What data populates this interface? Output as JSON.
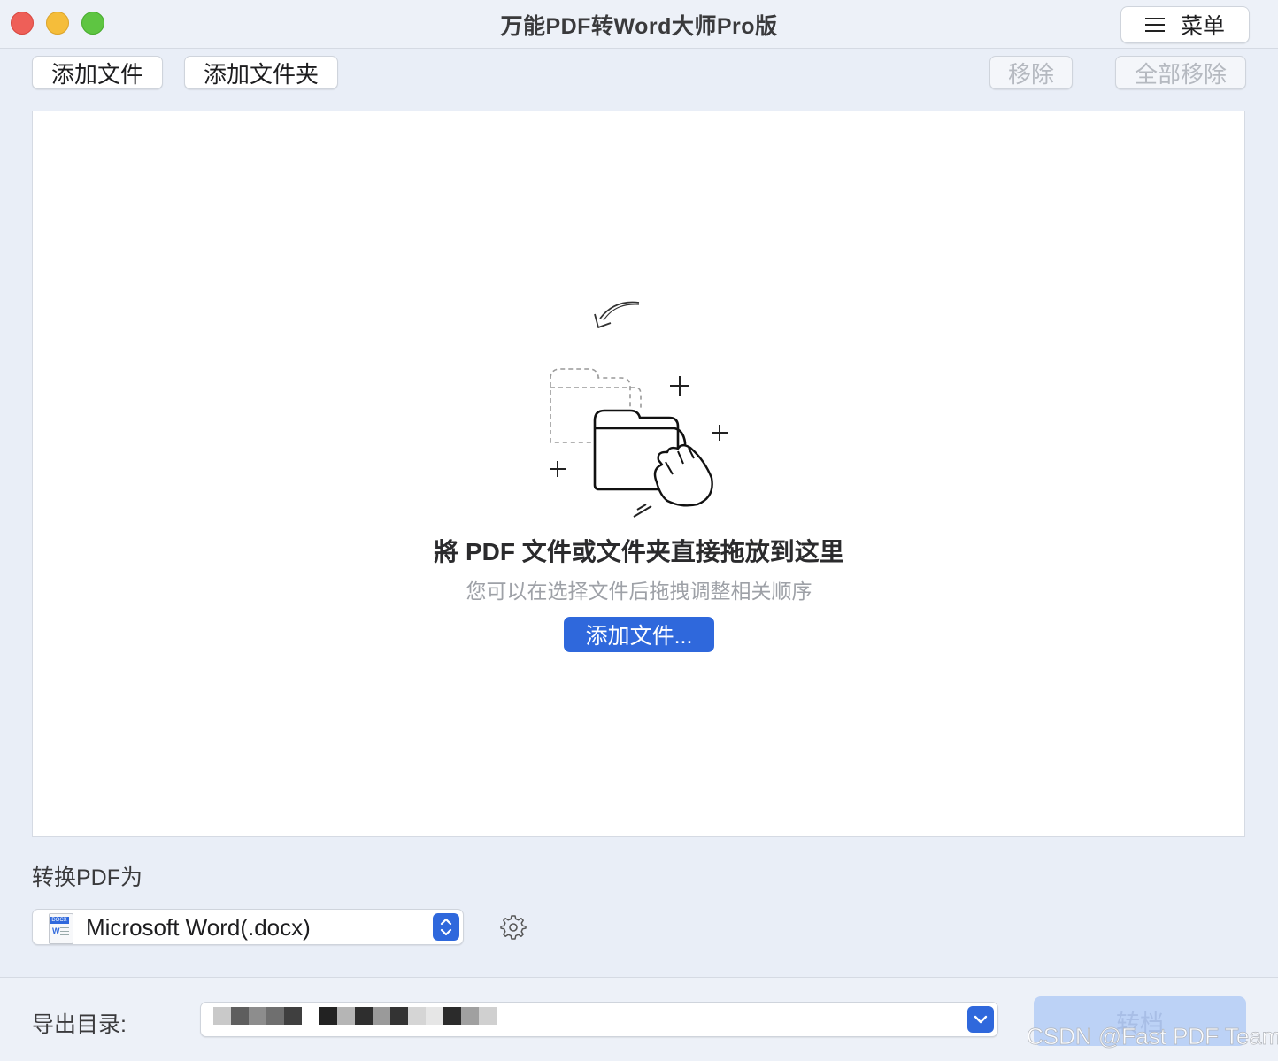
{
  "window": {
    "title": "万能PDF转Word大师Pro版",
    "menu_label": "菜单"
  },
  "toolbar": {
    "add_file": "添加文件",
    "add_folder": "添加文件夹",
    "remove": "移除",
    "remove_all": "全部移除"
  },
  "dropzone": {
    "title": "將 PDF  文件或文件夹直接拖放到这里",
    "subtitle": "您可以在选择文件后拖拽调整相关顺序",
    "add_button": "添加文件..."
  },
  "conversion": {
    "label": "转换PDF为",
    "format_value": "Microsoft Word(.docx)",
    "format_icon_tag": "DOCX",
    "format_icon_letter": "W"
  },
  "export": {
    "label": "导出目录:",
    "path_value_redacted": true
  },
  "actions": {
    "convert": "转档"
  },
  "watermark": "CSDN @Fast PDF Team",
  "colors": {
    "accent": "#2f68dc",
    "convert_disabled": "#bcd2f6",
    "window_bg": "#e9eef7"
  },
  "icons": {
    "close": "close-icon",
    "minimize": "minimize-icon",
    "maximize": "maximize-icon",
    "menu": "hamburger-icon",
    "gear": "gear-icon",
    "select_stepper": "chevron-updown-icon",
    "dropdown": "chevron-down-icon"
  }
}
